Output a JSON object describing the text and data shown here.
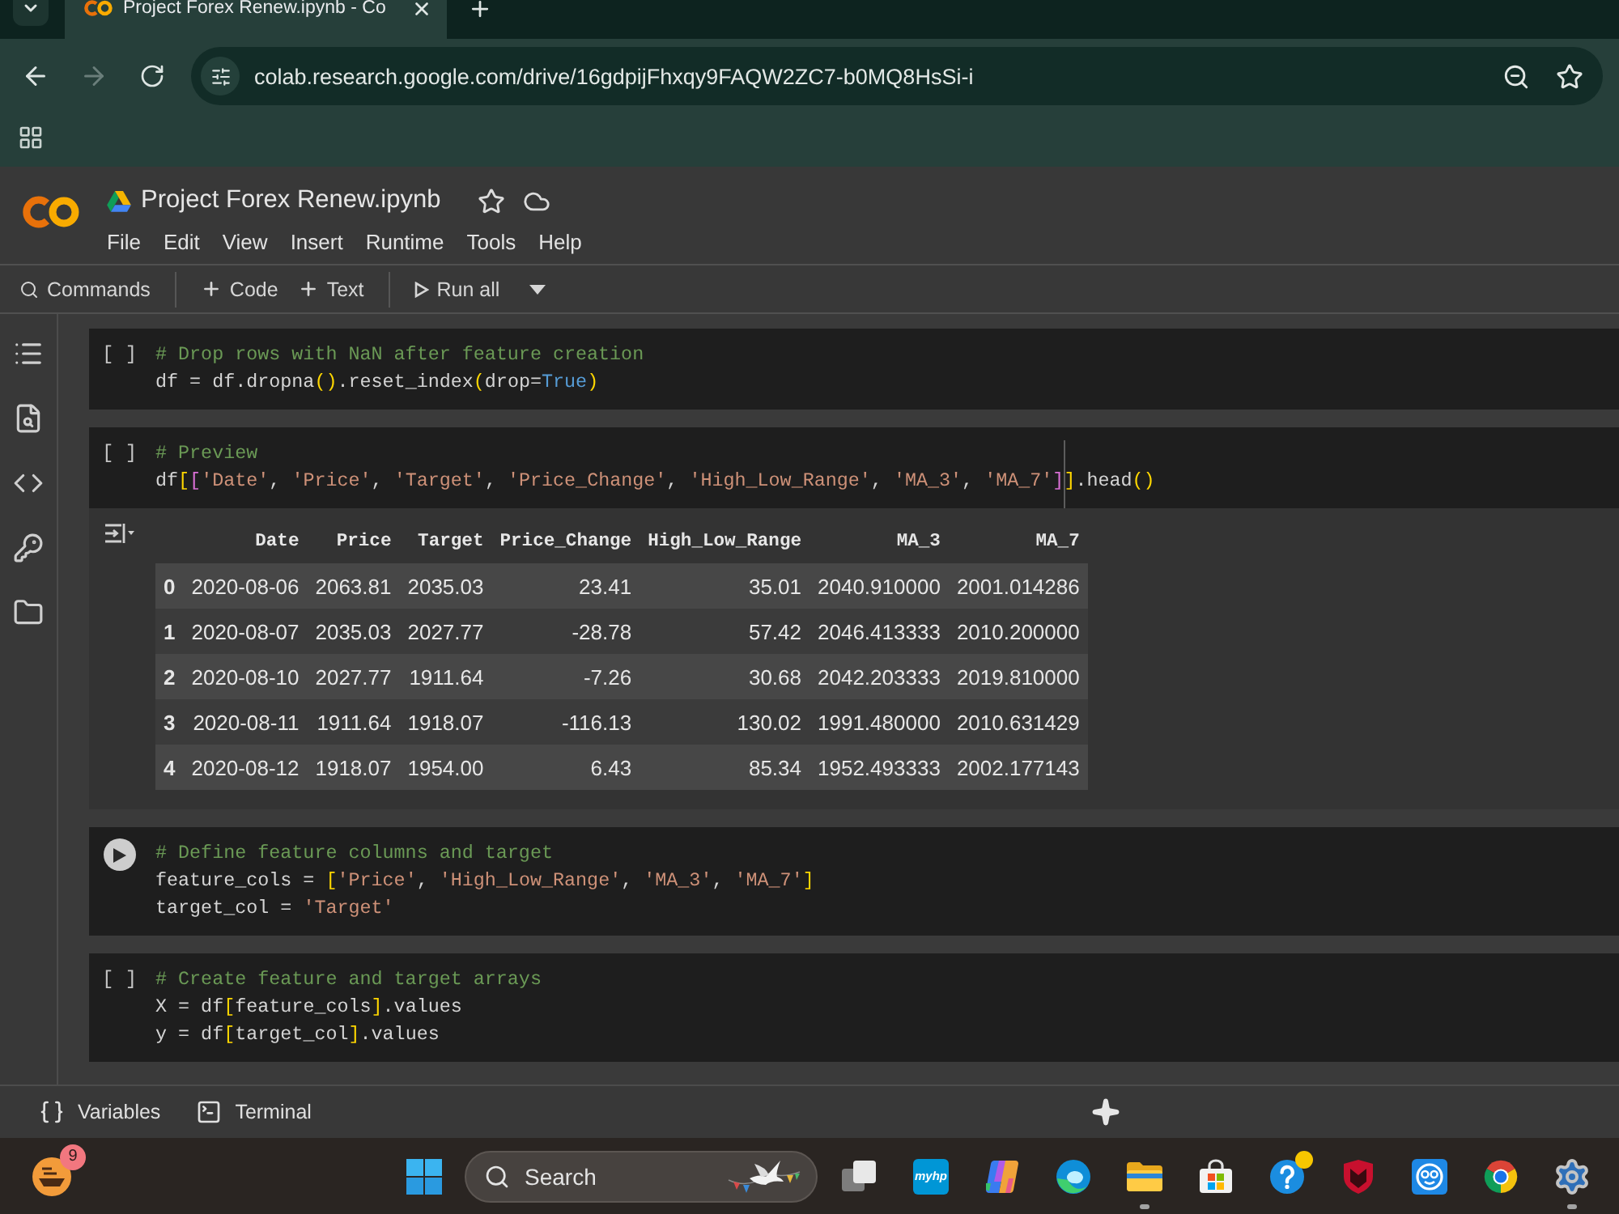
{
  "browser": {
    "tabs": [
      {
        "title": "Project Forex Renew.ipynb - Co",
        "selected": true
      }
    ],
    "nav": [
      {
        "kind": "back",
        "disabled": false
      },
      {
        "kind": "forward",
        "disabled": true
      },
      {
        "kind": "reload",
        "disabled": false
      }
    ],
    "address": "colab.research.google.com/drive/16gdpijFhxqy9FAQW2ZC7-b0MQ8HsSi-i"
  },
  "notebook": {
    "title": "Project Forex Renew.ipynb",
    "menu": [
      "File",
      "Edit",
      "View",
      "Insert",
      "Runtime",
      "Tools",
      "Help"
    ],
    "toolbar": [
      {
        "kind": "search",
        "label": "Commands"
      },
      {
        "kind": "add",
        "label": "Code"
      },
      {
        "kind": "add",
        "label": "Text"
      },
      {
        "kind": "run",
        "label": "Run all"
      }
    ]
  },
  "cells": [
    {
      "prompt": "[ ]",
      "focused": false,
      "ruler": false,
      "lines": [
        [
          {
            "kind": "comment",
            "text": "# Drop rows with NaN after feature creation"
          }
        ],
        [
          {
            "kind": "plain",
            "text": "df = df.dropna"
          },
          {
            "kind": "bracket1",
            "text": "()"
          },
          {
            "kind": "plain",
            "text": ".reset_index"
          },
          {
            "kind": "bracket1",
            "text": "("
          },
          {
            "kind": "plain",
            "text": "drop="
          },
          {
            "kind": "keyword",
            "text": "True"
          },
          {
            "kind": "bracket1",
            "text": ")"
          }
        ]
      ]
    },
    {
      "prompt": "[ ]",
      "focused": false,
      "ruler": true,
      "lines": [
        [
          {
            "kind": "comment",
            "text": "# Preview"
          }
        ],
        [
          {
            "kind": "plain",
            "text": "df"
          },
          {
            "kind": "bracket1",
            "text": "["
          },
          {
            "kind": "bracket2",
            "text": "["
          },
          {
            "kind": "string",
            "text": "'Date'"
          },
          {
            "kind": "plain",
            "text": ", "
          },
          {
            "kind": "string",
            "text": "'Price'"
          },
          {
            "kind": "plain",
            "text": ", "
          },
          {
            "kind": "string",
            "text": "'Target'"
          },
          {
            "kind": "plain",
            "text": ", "
          },
          {
            "kind": "string",
            "text": "'Price_Change'"
          },
          {
            "kind": "plain",
            "text": ", "
          },
          {
            "kind": "string",
            "text": "'High_Low_Range'"
          },
          {
            "kind": "plain",
            "text": ", "
          },
          {
            "kind": "string",
            "text": "'MA_3'"
          },
          {
            "kind": "plain",
            "text": ", "
          },
          {
            "kind": "string",
            "text": "'MA_7'"
          },
          {
            "kind": "bracket2",
            "text": "]"
          },
          {
            "kind": "bracket1",
            "text": "]"
          },
          {
            "kind": "plain",
            "text": ".head"
          },
          {
            "kind": "bracket1",
            "text": "()"
          }
        ]
      ],
      "output": {
        "table": {
          "columns": [
            "Date",
            "Price",
            "Target",
            "Price_Change",
            "High_Low_Range",
            "MA_3",
            "MA_7"
          ],
          "rows": [
            {
              "index": "0",
              "cells": [
                "2020-08-06",
                "2063.81",
                "2035.03",
                "23.41",
                "35.01",
                "2040.910000",
                "2001.014286"
              ]
            },
            {
              "index": "1",
              "cells": [
                "2020-08-07",
                "2035.03",
                "2027.77",
                "-28.78",
                "57.42",
                "2046.413333",
                "2010.200000"
              ]
            },
            {
              "index": "2",
              "cells": [
                "2020-08-10",
                "2027.77",
                "1911.64",
                "-7.26",
                "30.68",
                "2042.203333",
                "2019.810000"
              ]
            },
            {
              "index": "3",
              "cells": [
                "2020-08-11",
                "1911.64",
                "1918.07",
                "-116.13",
                "130.02",
                "1991.480000",
                "2010.631429"
              ]
            },
            {
              "index": "4",
              "cells": [
                "2020-08-12",
                "1918.07",
                "1954.00",
                "6.43",
                "85.34",
                "1952.493333",
                "2002.177143"
              ]
            }
          ]
        }
      }
    },
    {
      "focused": true,
      "ruler": false,
      "lines": [
        [
          {
            "kind": "comment",
            "text": "# Define feature columns and target"
          }
        ],
        [
          {
            "kind": "plain",
            "text": "feature_cols = "
          },
          {
            "kind": "bracket1",
            "text": "["
          },
          {
            "kind": "string",
            "text": "'Price'"
          },
          {
            "kind": "plain",
            "text": ", "
          },
          {
            "kind": "string",
            "text": "'High_Low_Range'"
          },
          {
            "kind": "plain",
            "text": ", "
          },
          {
            "kind": "string",
            "text": "'MA_3'"
          },
          {
            "kind": "plain",
            "text": ", "
          },
          {
            "kind": "string",
            "text": "'MA_7'"
          },
          {
            "kind": "bracket1",
            "text": "]"
          }
        ],
        [
          {
            "kind": "plain",
            "text": "target_col = "
          },
          {
            "kind": "string",
            "text": "'Target'"
          }
        ]
      ]
    },
    {
      "prompt": "[ ]",
      "focused": false,
      "ruler": false,
      "lines": [
        [
          {
            "kind": "comment",
            "text": "# Create feature and target arrays"
          }
        ],
        [
          {
            "kind": "plain",
            "text": "X = df"
          },
          {
            "kind": "bracket1",
            "text": "["
          },
          {
            "kind": "plain",
            "text": "feature_cols"
          },
          {
            "kind": "bracket1",
            "text": "]"
          },
          {
            "kind": "plain",
            "text": ".values"
          }
        ],
        [
          {
            "kind": "plain",
            "text": "y = df"
          },
          {
            "kind": "bracket1",
            "text": "["
          },
          {
            "kind": "plain",
            "text": "target_col"
          },
          {
            "kind": "bracket1",
            "text": "]"
          },
          {
            "kind": "plain",
            "text": ".values"
          }
        ]
      ]
    }
  ],
  "status_bar": {
    "items": [
      {
        "kind": "variables",
        "label": "Variables"
      },
      {
        "kind": "terminal",
        "label": "Terminal"
      }
    ]
  },
  "taskbar": {
    "widget_badge": "9",
    "search_placeholder": "Search",
    "apps": [
      {
        "kind": "taskview",
        "running": false,
        "alert": false
      },
      {
        "kind": "myhp",
        "label": "myhp",
        "running": false,
        "alert": false
      },
      {
        "kind": "copilot",
        "running": false,
        "alert": false
      },
      {
        "kind": "edge",
        "running": false,
        "alert": false
      },
      {
        "kind": "explorer",
        "running": true,
        "alert": false
      },
      {
        "kind": "store",
        "running": false,
        "alert": false
      },
      {
        "kind": "help",
        "running": false,
        "alert": true
      },
      {
        "kind": "shield",
        "running": false,
        "alert": false
      },
      {
        "kind": "face",
        "running": false,
        "alert": false
      },
      {
        "kind": "chrome",
        "running": false,
        "alert": false
      },
      {
        "kind": "settings",
        "running": true,
        "alert": false
      }
    ]
  }
}
